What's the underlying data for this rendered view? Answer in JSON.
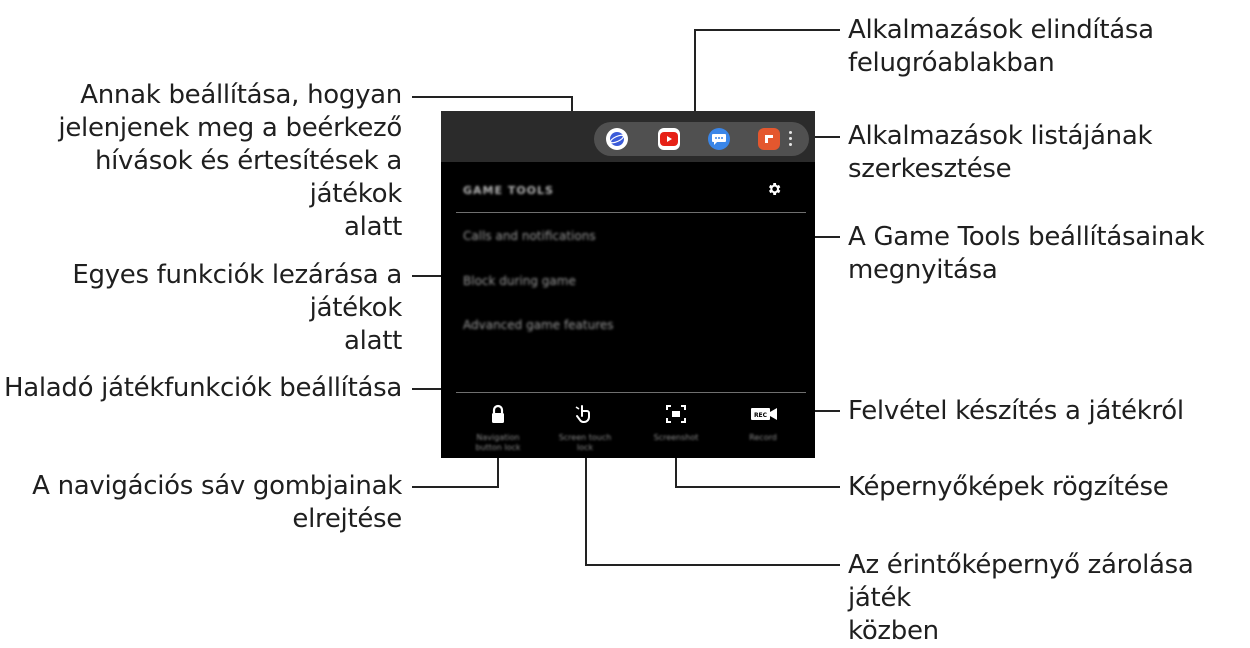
{
  "callouts": {
    "popup_apps": [
      "Alkalmazások elindítása",
      "felugróablakban"
    ],
    "incoming_calls": [
      "Annak beállítása, hogyan",
      "jelenjenek meg a beérkező",
      "hívások és értesítések a játékok",
      "alatt"
    ],
    "edit_apps": [
      "Alkalmazások listájának",
      "szerkesztése"
    ],
    "open_settings": [
      "A Game Tools beállításainak",
      "megnyitása"
    ],
    "block_features": [
      "Egyes funkciók lezárása a játékok",
      "alatt"
    ],
    "advanced": [
      "Haladó játékfunkciók beállítása"
    ],
    "record": [
      "Felvétel készítés a játékról"
    ],
    "hide_nav": [
      "A navigációs sáv gombjainak",
      "elrejtése"
    ],
    "screenshot": [
      "Képernyőképek rögzítése"
    ],
    "touch_lock": [
      "Az érintőképernyő zárolása játék",
      "közben"
    ]
  },
  "screen": {
    "title": "GAME TOOLS",
    "menu": [
      "Calls and notifications",
      "Block during game",
      "Advanced game features"
    ],
    "tools": [
      {
        "label1": "Navigation",
        "label2": "button lock",
        "icon": "lock-icon"
      },
      {
        "label1": "Screen touch",
        "label2": "lock",
        "icon": "touch-icon"
      },
      {
        "label1": "Screenshot",
        "label2": "",
        "icon": "screenshot-icon"
      },
      {
        "label1": "Record",
        "label2": "",
        "icon": "record-icon"
      }
    ],
    "apps": [
      "internet-icon",
      "youtube-icon",
      "messages-icon",
      "flipboard-icon"
    ],
    "record_badge": "REC"
  },
  "colors": {
    "screen_bg": "#000000",
    "top_bar": "#2b2b2b",
    "tray": "#505050",
    "leader_line": "#222222",
    "internet": "#3b5bd9",
    "youtube": "#e62117",
    "messages": "#3a86e8",
    "flipboard": "#e4572e"
  }
}
